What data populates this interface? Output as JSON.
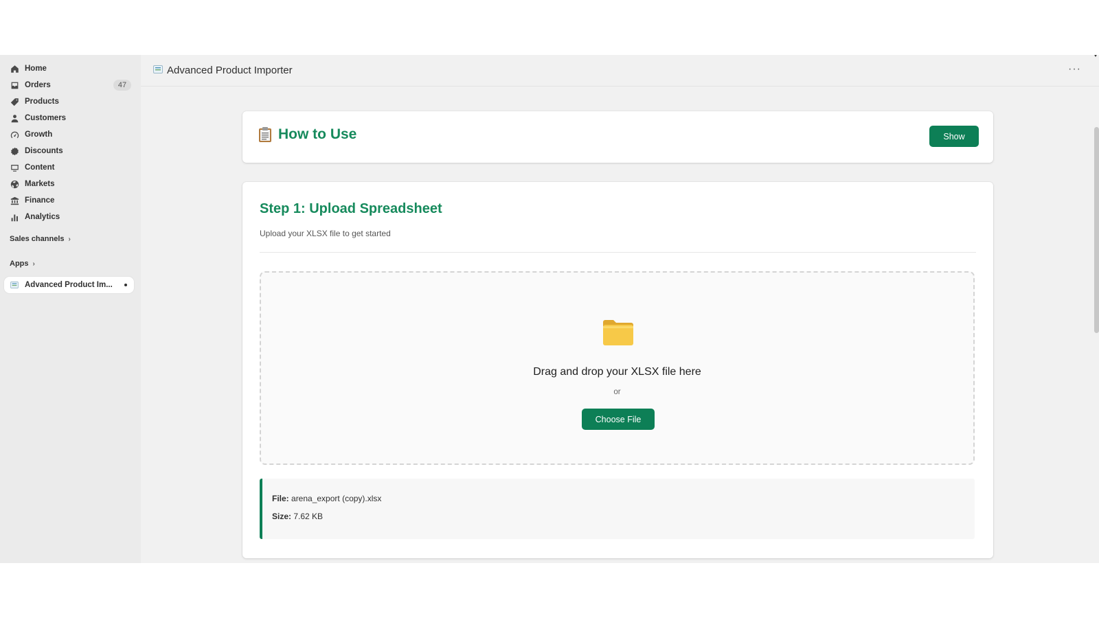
{
  "sidebar": {
    "items": [
      {
        "label": "Home",
        "icon": "home-icon"
      },
      {
        "label": "Orders",
        "icon": "orders-icon",
        "badge": "47"
      },
      {
        "label": "Products",
        "icon": "tag-icon"
      },
      {
        "label": "Customers",
        "icon": "person-icon"
      },
      {
        "label": "Growth",
        "icon": "gauge-icon"
      },
      {
        "label": "Discounts",
        "icon": "discount-icon"
      },
      {
        "label": "Content",
        "icon": "content-icon"
      },
      {
        "label": "Markets",
        "icon": "globe-icon"
      },
      {
        "label": "Finance",
        "icon": "bank-icon"
      },
      {
        "label": "Analytics",
        "icon": "bar-chart-icon"
      }
    ],
    "sales_channels_label": "Sales channels",
    "apps_label": "Apps",
    "app_item_label": "Advanced Product Im..."
  },
  "header": {
    "title": "Advanced Product Importer",
    "more_label": "···"
  },
  "how_to_use": {
    "title": "How to Use",
    "show_label": "Show"
  },
  "step1": {
    "title": "Step 1: Upload Spreadsheet",
    "subtitle": "Upload your XLSX file to get started",
    "drop_text": "Drag and drop your XLSX file here",
    "or_text": "or",
    "choose_label": "Choose File"
  },
  "file_info": {
    "file_label": "File:",
    "file_name": "arena_export (copy).xlsx",
    "size_label": "Size:",
    "size_value": "7.62 KB"
  },
  "colors": {
    "accent": "#0d7f56",
    "heading_green": "#168a5c",
    "sidebar_bg": "#ebebeb",
    "page_bg": "#f1f1f1"
  }
}
